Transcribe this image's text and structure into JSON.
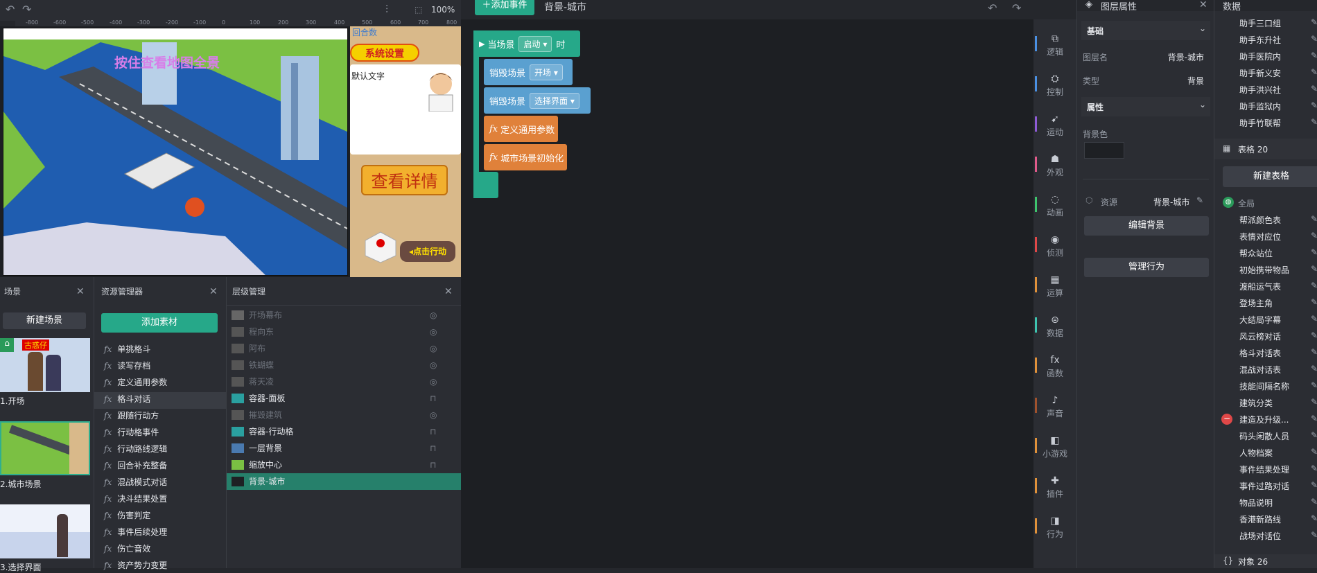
{
  "toolbar": {
    "zoom": "100%"
  },
  "ruler": [
    "-800",
    "-600",
    "-500",
    "-400",
    "-300",
    "-200",
    "-100",
    "0",
    "100",
    "200",
    "300",
    "400",
    "500",
    "600",
    "700",
    "800"
  ],
  "game_preview": {
    "banner_text": "按住查看地图全景",
    "round_label": "回合数",
    "system_settings": "系统设置",
    "default_text": "默认文字",
    "view_details": "查看详情",
    "click_action": "◂点击行动"
  },
  "scene_panel": {
    "title": "场景",
    "new_scene": "新建场景",
    "scenes": [
      {
        "label": "1.开场",
        "thumb_text": "古惑仔"
      },
      {
        "label": "2.城市场景"
      },
      {
        "label": "3.选择界面"
      }
    ]
  },
  "resource_panel": {
    "title": "资源管理器",
    "add_material": "添加素材",
    "items": [
      "单挑格斗",
      "读写存档",
      "定义通用参数",
      "格斗对话",
      "跟随行动方",
      "行动格事件",
      "行动路线逻辑",
      "回合补充整备",
      "混战模式对话",
      "决斗结果处置",
      "伤害判定",
      "事件后续处理",
      "伤亡音效",
      "资产势力变更"
    ]
  },
  "layer_panel": {
    "title": "层级管理",
    "layers": [
      {
        "name": "开场幕布",
        "state": "hidden"
      },
      {
        "name": "程向东",
        "state": "hidden"
      },
      {
        "name": "阿布",
        "state": "hidden"
      },
      {
        "name": "铁蝴蝶",
        "state": "hidden"
      },
      {
        "name": "蒋天凌",
        "state": "hidden"
      },
      {
        "name": "容器-面板",
        "state": "locked"
      },
      {
        "name": "摧毁建筑",
        "state": "hidden"
      },
      {
        "name": "容器-行动格",
        "state": "locked"
      },
      {
        "name": "一层背景",
        "state": "locked"
      },
      {
        "name": "缩放中心",
        "state": "locked"
      },
      {
        "name": "背景-城市",
        "state": "selected"
      }
    ]
  },
  "events": {
    "add_event": "添加事件",
    "breadcrumb": "背景-城市",
    "trigger": {
      "prefix": "当场景",
      "value": "启动",
      "suffix": "时"
    },
    "blocks": [
      {
        "type": "destroy",
        "label": "销毁场景",
        "value": "开场"
      },
      {
        "type": "destroy",
        "label": "销毁场景",
        "value": "选择界面"
      },
      {
        "type": "func",
        "label": "定义通用参数"
      },
      {
        "type": "func",
        "label": "城市场景初始化"
      }
    ]
  },
  "toolbox": [
    {
      "label": "逻辑",
      "color": "#4a90e2",
      "icon": "logic-icon"
    },
    {
      "label": "控制",
      "color": "#4a90e2",
      "icon": "control-icon"
    },
    {
      "label": "运动",
      "color": "#8e5bd6",
      "icon": "run-icon"
    },
    {
      "label": "外观",
      "color": "#e05a8a",
      "icon": "shirt-icon"
    },
    {
      "label": "动画",
      "color": "#3ec46d",
      "icon": "animation-icon"
    },
    {
      "label": "侦测",
      "color": "#e04848",
      "icon": "radar-icon"
    },
    {
      "label": "运算",
      "color": "#e0913a",
      "icon": "calc-icon"
    },
    {
      "label": "数据",
      "color": "#3ec4b0",
      "icon": "var-icon"
    },
    {
      "label": "函数",
      "color": "#e0913a",
      "icon": "fx-icon"
    },
    {
      "label": "声音",
      "color": "#a0522d",
      "icon": "mic-icon"
    },
    {
      "label": "小游戏",
      "color": "#e0913a",
      "icon": "game-icon"
    },
    {
      "label": "插件",
      "color": "#e0913a",
      "icon": "plugin-icon"
    },
    {
      "label": "行为",
      "color": "#e0913a",
      "icon": "behavior-icon"
    }
  ],
  "props": {
    "title": "图层属性",
    "basic": "基础",
    "layer_name_label": "图层名",
    "layer_name_value": "背景-城市",
    "type_label": "类型",
    "type_value": "背景",
    "attributes": "属性",
    "bg_color_label": "背景色",
    "resource_label": "资源",
    "resource_value": "背景-城市",
    "edit_bg": "编辑背景",
    "manage_behavior": "管理行为"
  },
  "data_panel": {
    "title": "数据",
    "top_items": [
      "助手三口组",
      "助手东升社",
      "助手医院内",
      "助手新义安",
      "助手洪兴社",
      "助手监狱内",
      "助手竹联帮"
    ],
    "table_header": "表格 20",
    "new_table": "新建表格",
    "global_label": "全局",
    "global_items": [
      "帮派颜色表",
      "表情对应位",
      "帮众站位",
      "初始携带物品",
      "渡船运气表",
      "登场主角",
      "大结局字幕",
      "风云榜对话",
      "格斗对话表",
      "混战对话表",
      "技能间隔名称",
      "建筑分类",
      "建造及升级...",
      "码头闲散人员",
      "人物档案",
      "事件结果处理",
      "事件过路对话",
      "物品说明",
      "香港新路线",
      "战场对话位"
    ],
    "objects_header": "对象 26"
  }
}
